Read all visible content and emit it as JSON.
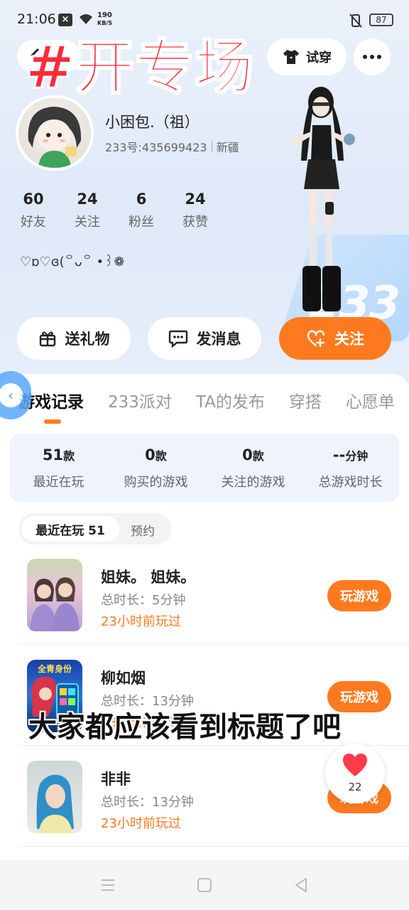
{
  "status_bar": {
    "time": "21:06",
    "notif_badge": "×",
    "net_speed_value": "190",
    "net_speed_unit": "KB/S",
    "battery": "87"
  },
  "overlay": {
    "banner": "#开专场",
    "caption": "大家都应该看到标题了吧"
  },
  "header": {
    "tryon_label": "试穿"
  },
  "profile": {
    "nickname": "小困包.（祖）",
    "uid": "233号:435699423",
    "region": "新疆",
    "bio": "♡ɒ♡ɞ(꒪ᴗ꒪ •꒱❁",
    "stats": [
      {
        "num": "60",
        "label": "好友"
      },
      {
        "num": "24",
        "label": "关注"
      },
      {
        "num": "6",
        "label": "粉丝"
      },
      {
        "num": "24",
        "label": "获赞"
      }
    ]
  },
  "actions": {
    "gift": "送礼物",
    "message": "发消息",
    "follow": "关注"
  },
  "tabs": [
    "游戏记录",
    "233派对",
    "TA的发布",
    "穿搭",
    "心愿单"
  ],
  "summary": [
    {
      "num": "51",
      "unit": "款",
      "label": "最近在玩"
    },
    {
      "num": "0",
      "unit": "款",
      "label": "购买的游戏"
    },
    {
      "num": "0",
      "unit": "款",
      "label": "关注的游戏"
    },
    {
      "num": "--",
      "unit": "分钟",
      "label": "总游戏时长"
    }
  ],
  "subtabs": {
    "recent": "最近在玩 51",
    "reserve": "预约"
  },
  "games": [
    {
      "title": "姐妹。   姐妹。",
      "duration": "总时长：5分钟",
      "last": "23小时前玩过",
      "button": "玩游戏"
    },
    {
      "title": "柳如烟",
      "duration": "总时长：13分钟",
      "last": "23小时前玩过",
      "button": "玩游戏",
      "thumb_text": "全青身份"
    },
    {
      "title": "非非",
      "duration": "总时长：13分钟",
      "last": "23小时前玩过",
      "button": "玩游戏"
    }
  ],
  "like": {
    "count": "22"
  },
  "hero_deco": "233",
  "colors": {
    "accent": "#ff7a1f",
    "banner_red": "#ff2b3a",
    "summary_bg": "#eef3fc"
  },
  "icons": {
    "back": "chevron-left-icon",
    "tryon": "tshirt-icon",
    "more": "more-dots-icon",
    "gift": "gift-icon",
    "message": "chat-bubble-icon",
    "follow": "heart-plus-icon",
    "like": "heart-icon"
  }
}
